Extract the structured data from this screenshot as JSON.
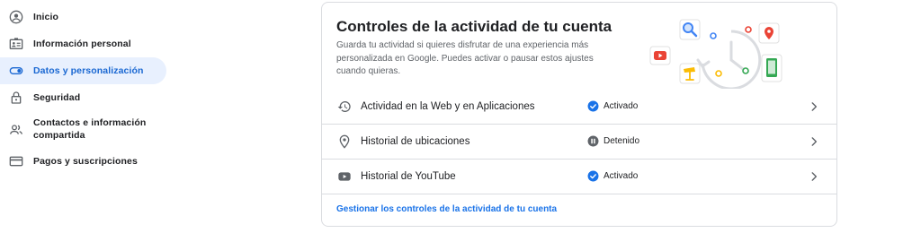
{
  "sidebar": {
    "items": [
      {
        "label": "Inicio",
        "icon": "account-circle-icon",
        "active": false
      },
      {
        "label": "Información personal",
        "icon": "id-card-icon",
        "active": false
      },
      {
        "label": "Datos y personalización",
        "icon": "toggle-icon",
        "active": true
      },
      {
        "label": "Seguridad",
        "icon": "lock-icon",
        "active": false
      },
      {
        "label": "Contactos e información compartida",
        "icon": "people-icon",
        "active": false
      },
      {
        "label": "Pagos y suscripciones",
        "icon": "credit-card-icon",
        "active": false
      }
    ]
  },
  "card": {
    "title": "Controles de la actividad de tu cuenta",
    "description": "Guarda tu actividad si quieres disfrutar de una experiencia más personalizada en Google. Puedes activar o pausar estos ajustes cuando quieras.",
    "rows": [
      {
        "label": "Actividad en la Web y en Aplicaciones",
        "icon": "history-icon",
        "status": "Activado",
        "status_icon": "check-circle-icon"
      },
      {
        "label": "Historial de ubicaciones",
        "icon": "location-pin-icon",
        "status": "Detenido",
        "status_icon": "pause-circle-icon"
      },
      {
        "label": "Historial de YouTube",
        "icon": "youtube-icon",
        "status": "Activado",
        "status_icon": "check-circle-icon"
      }
    ],
    "manage_link": "Gestionar los controles de la actividad de tu cuenta"
  },
  "colors": {
    "accent": "#1a73e8",
    "active_nav_bg": "#e8f0fe",
    "active_nav_text": "#1967d2",
    "status_active": "#1a73e8",
    "status_paused": "#5f6368"
  }
}
